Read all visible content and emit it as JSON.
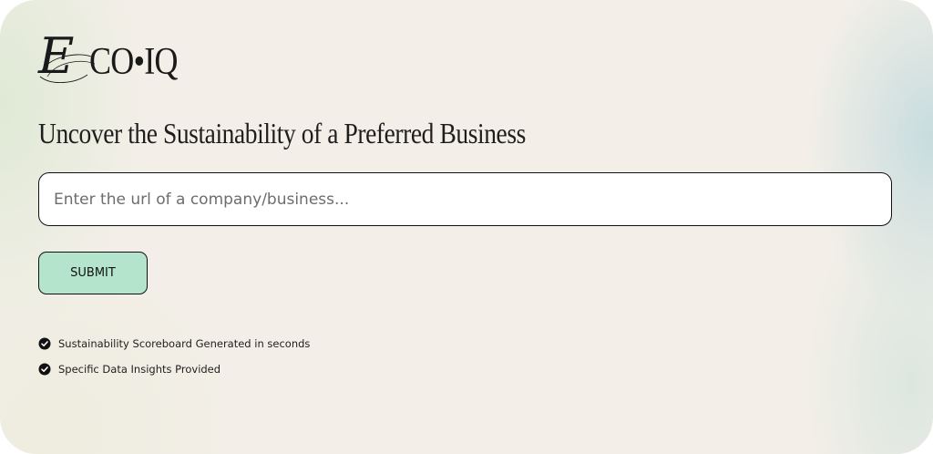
{
  "brand": {
    "logo_initial": "E",
    "logo_rest": "CO•IQ"
  },
  "main": {
    "headline": "Uncover the Sustainability of a Preferred Business",
    "url_input": {
      "value": "",
      "placeholder": "Enter the url of a company/business..."
    },
    "submit_label": "SUBMIT"
  },
  "features": [
    {
      "icon": "check-circle-icon",
      "text": "Sustainability Scoreboard Generated in seconds"
    },
    {
      "icon": "check-circle-icon",
      "text": "Specific Data Insights Provided"
    }
  ],
  "colors": {
    "background": "#f3efe8",
    "submit_bg": "#b5e4cc",
    "text": "#1e1e1e",
    "border": "#111111"
  }
}
